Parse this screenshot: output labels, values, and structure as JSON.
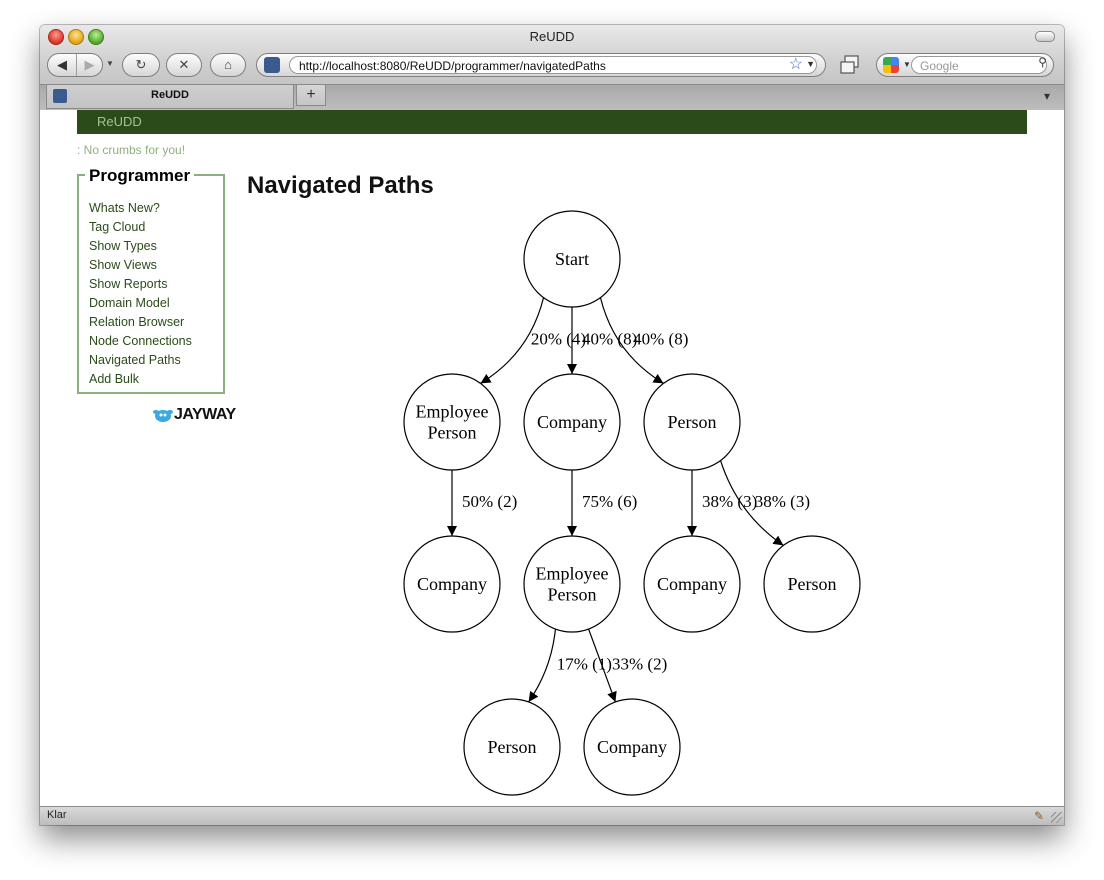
{
  "browser": {
    "window_title": "ReUDD",
    "url": "http://localhost:8080/ReUDD/programmer/navigatedPaths",
    "search_placeholder": "Google",
    "tab_label": "ReUDD",
    "new_tab_label": "+",
    "status": "Klar"
  },
  "site": {
    "brand": "ReUDD",
    "crumbs": ": No crumbs for you!",
    "menu": {
      "title": "Programmer",
      "items": [
        "Whats New?",
        "Tag Cloud",
        "Show Types",
        "Show Views",
        "Show Reports",
        "Domain Model",
        "Relation Browser",
        "Node Connections",
        "Navigated Paths",
        "Add Bulk"
      ]
    },
    "logo_text": "JAYWAY"
  },
  "main": {
    "title": "Navigated Paths"
  },
  "graph": {
    "nodes": [
      {
        "id": "start",
        "lines": [
          "Start"
        ]
      },
      {
        "id": "ep1",
        "lines": [
          "Employee",
          "Person"
        ]
      },
      {
        "id": "c1",
        "lines": [
          "Company"
        ]
      },
      {
        "id": "p1",
        "lines": [
          "Person"
        ]
      },
      {
        "id": "c2",
        "lines": [
          "Company"
        ]
      },
      {
        "id": "ep2",
        "lines": [
          "Employee",
          "Person"
        ]
      },
      {
        "id": "c3",
        "lines": [
          "Company"
        ]
      },
      {
        "id": "p2",
        "lines": [
          "Person"
        ]
      },
      {
        "id": "p3",
        "lines": [
          "Person"
        ]
      },
      {
        "id": "c4",
        "lines": [
          "Company"
        ]
      }
    ],
    "edges": [
      {
        "from": "start",
        "to": "ep1",
        "label": "20% (4)"
      },
      {
        "from": "start",
        "to": "c1",
        "label": "40% (8)"
      },
      {
        "from": "start",
        "to": "p1",
        "label": "40% (8)"
      },
      {
        "from": "ep1",
        "to": "c2",
        "label": "50% (2)"
      },
      {
        "from": "c1",
        "to": "ep2",
        "label": "75% (6)"
      },
      {
        "from": "p1",
        "to": "c3",
        "label": "38% (3)"
      },
      {
        "from": "p1",
        "to": "p2",
        "label": "38% (3)"
      },
      {
        "from": "ep2",
        "to": "p3",
        "label": "17% (1)"
      },
      {
        "from": "ep2",
        "to": "c4",
        "label": "33% (2)"
      }
    ]
  }
}
